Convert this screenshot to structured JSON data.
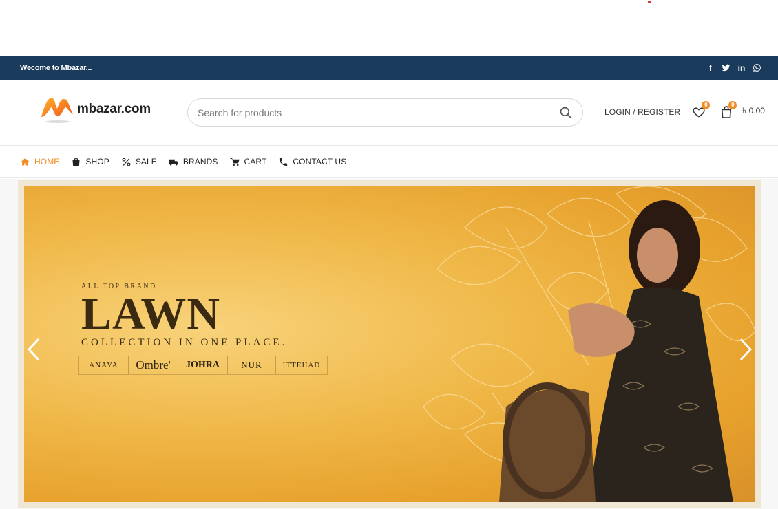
{
  "topbar": {
    "welcome": "Wecome to Mbazar...",
    "social": [
      {
        "icon": "facebook-icon",
        "glyph": "f"
      },
      {
        "icon": "twitter-icon",
        "glyph": ""
      },
      {
        "icon": "linkedin-icon",
        "glyph": "in"
      },
      {
        "icon": "whatsapp-icon",
        "glyph": ""
      }
    ]
  },
  "header": {
    "logo_text": "mbazar.com",
    "search_placeholder": "Search for products",
    "login_label": "LOGIN / REGISTER",
    "wishlist_count": "0",
    "cart_count": "0",
    "cart_total": "৳ 0.00"
  },
  "nav": {
    "items": [
      {
        "label": "HOME",
        "icon": "home-icon",
        "active": true
      },
      {
        "label": "SHOP",
        "icon": "bag-icon",
        "active": false
      },
      {
        "label": "SALE",
        "icon": "percent-icon",
        "active": false
      },
      {
        "label": "BRANDS",
        "icon": "truck-icon",
        "active": false
      },
      {
        "label": "CART",
        "icon": "cart-icon",
        "active": false
      },
      {
        "label": "CONTACT US",
        "icon": "phone-icon",
        "active": false
      }
    ]
  },
  "hero": {
    "eyebrow": "ALL TOP BRAND",
    "headline": "LAWN",
    "subline": "COLLECTION IN ONE PLACE.",
    "brands": [
      "ANAYA",
      "Ombre'",
      "JOHRA",
      "NUR",
      "ITTEHAD"
    ]
  },
  "colors": {
    "topbar_bg": "#1b3b5c",
    "accent": "#f18b24"
  }
}
